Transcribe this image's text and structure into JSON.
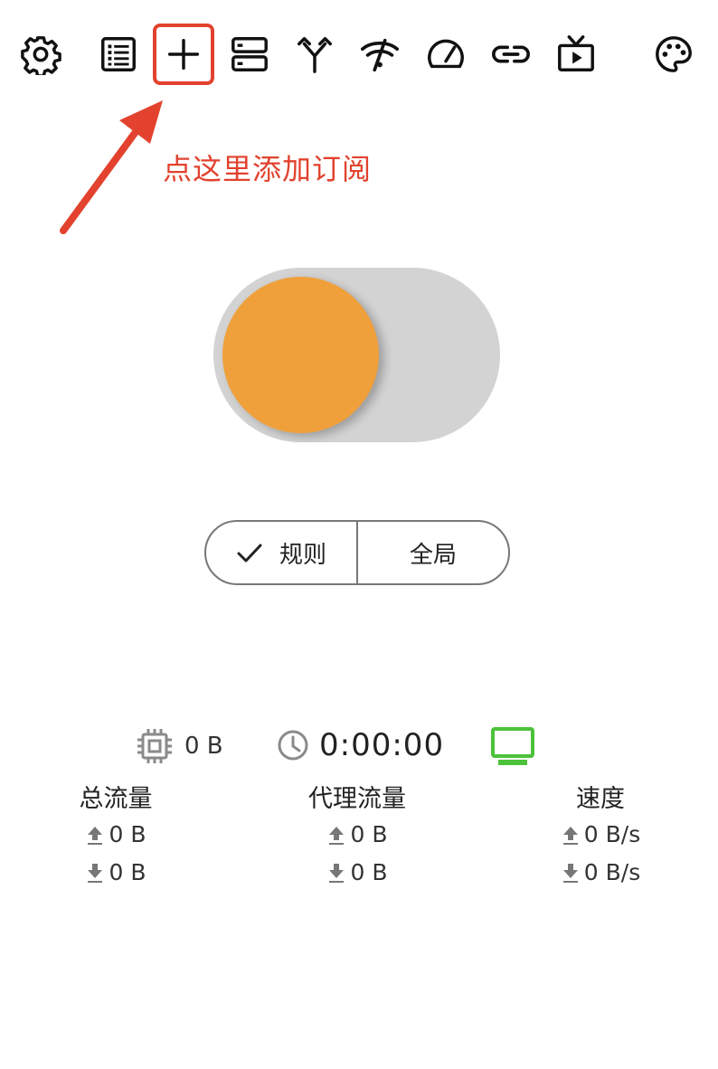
{
  "toolbar": {
    "icons": [
      "gear-icon",
      "list-icon",
      "plus-icon",
      "server-icon",
      "fork-icon",
      "wifi-off-icon",
      "speedometer-icon",
      "link-icon",
      "tv-play-icon",
      "palette-icon"
    ],
    "highlight_color": "#e2422e"
  },
  "annotation": {
    "text": "点这里添加订阅"
  },
  "proxy_toggle": {
    "state": "off",
    "knob_color": "#f0a03b",
    "track_color": "#d3d3d3"
  },
  "mode": {
    "rule_label": "规则",
    "global_label": "全局",
    "selected": "规则"
  },
  "stats": {
    "memory": "0 B",
    "uptime": "0:00:00",
    "status_color": "#4cc23a"
  },
  "traffic": {
    "total": {
      "title": "总流量",
      "up": "0 B",
      "down": "0 B"
    },
    "proxy": {
      "title": "代理流量",
      "up": "0 B",
      "down": "0 B"
    },
    "speed": {
      "title": "速度",
      "up": "0 B/s",
      "down": "0 B/s"
    }
  }
}
